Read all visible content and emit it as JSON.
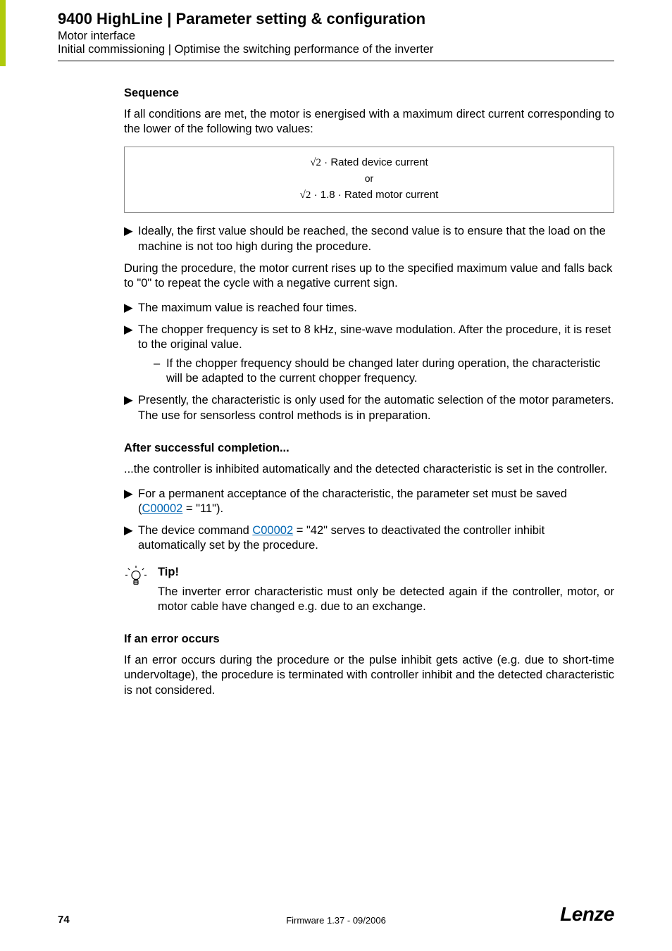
{
  "header": {
    "title": "9400 HighLine | Parameter setting & configuration",
    "sub1": "Motor interface",
    "sub2": "Initial commissioning | Optimise the switching performance of the inverter"
  },
  "seq": {
    "heading": "Sequence",
    "intro": "If all conditions are met, the motor is energised with a maximum direct current corresponding to the lower of the following two values:",
    "f1a": " · Rated device current",
    "or": "or",
    "f2a": " · 1.8 · Rated motor current",
    "b1": "Ideally, the first value should be reached, the second value is to ensure that the load on the machine is not too high during the procedure.",
    "mid": "During the procedure, the motor current rises up to the specified maximum value and falls back to \"0\" to repeat the cycle with a negative current sign.",
    "b2": "The maximum value is reached four times.",
    "b3": "The chopper frequency is set to 8 kHz, sine-wave modulation. After the procedure, it is reset to the original value.",
    "b3s": "If the chopper frequency should be changed later during operation, the characteristic will be adapted to the current chopper frequency.",
    "b4": "Presently, the characteristic is only used for the automatic selection of the motor parameters. The use for sensorless control methods is in preparation."
  },
  "after": {
    "heading": "After successful completion...",
    "intro": "...the controller is inhibited automatically and the detected characteristic is set in the controller.",
    "b1a": "For a permanent acceptance of the characteristic, the parameter set must be saved (",
    "b1link": "C00002",
    "b1b": " = \"11\").",
    "b2a": "The device command ",
    "b2link": "C00002",
    "b2b": " = \"42\" serves to deactivated the controller inhibit automatically set by the procedure."
  },
  "tip": {
    "heading": "Tip!",
    "body": "The inverter error characteristic must only be detected again if the controller, motor, or motor cable have changed e.g. due to an exchange."
  },
  "err": {
    "heading": "If an error occurs",
    "body": "If an error occurs during the procedure or the pulse inhibit gets active (e.g. due to short-time undervoltage), the procedure is terminated with controller inhibit and the detected characteristic is not considered."
  },
  "footer": {
    "page": "74",
    "firmware": "Firmware 1.37 - 09/2006",
    "brand": "Lenze"
  }
}
